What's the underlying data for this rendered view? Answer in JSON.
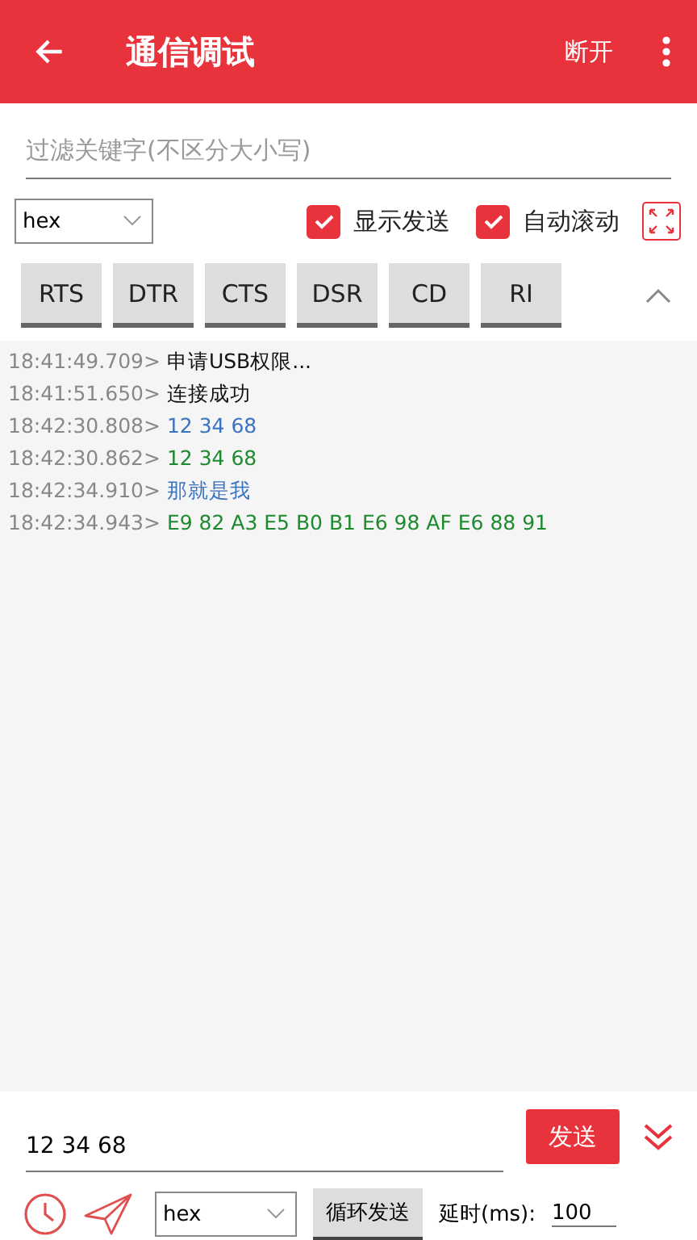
{
  "header": {
    "title": "通信调试",
    "action": "断开"
  },
  "filter": {
    "placeholder": "过滤关键字(不区分大小写)"
  },
  "options": {
    "format": "hex",
    "toggles": [
      {
        "label": "显示发送",
        "checked": true
      },
      {
        "label": "自动滚动",
        "checked": true
      }
    ]
  },
  "signals": [
    {
      "label": "RTS"
    },
    {
      "label": "DTR"
    },
    {
      "label": "CTS"
    },
    {
      "label": "DSR"
    },
    {
      "label": "CD"
    },
    {
      "label": "RI"
    }
  ],
  "log": [
    {
      "time": "18:41:49.709>",
      "text": "申请USB权限...",
      "kind": "info"
    },
    {
      "time": "18:41:51.650>",
      "text": "连接成功",
      "kind": "info"
    },
    {
      "time": "18:42:30.808>",
      "text": "12 34 68",
      "kind": "sent"
    },
    {
      "time": "18:42:30.862>",
      "text": "12 34 68",
      "kind": "received"
    },
    {
      "time": "18:42:34.910>",
      "text": "那就是我",
      "kind": "sent"
    },
    {
      "time": "18:42:34.943>",
      "text": "E9 82 A3 E5 B0 B1 E6 98 AF E6 88 91",
      "kind": "received"
    }
  ],
  "send": {
    "value": "12 34 68",
    "button": "发送"
  },
  "footer": {
    "format": "hex",
    "loop_button": "循环发送",
    "delay_label": "延时(ms):",
    "delay_value": "100"
  }
}
